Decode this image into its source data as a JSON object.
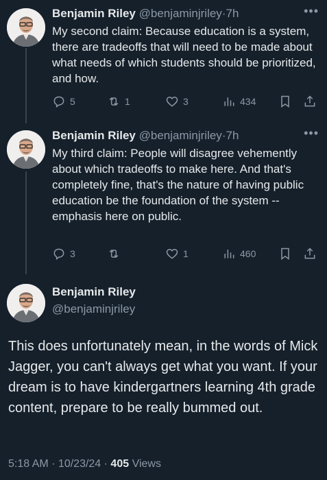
{
  "colors": {
    "background": "#15202b",
    "text": "#e7e9ea",
    "muted": "#8b98a5",
    "thread_line": "#38444d"
  },
  "tweets": [
    {
      "name": "Benjamin Riley",
      "handle": "@benjaminjriley",
      "sep": "·",
      "time": "7h",
      "text": "My second claim: Because education is a system, there are tradeoffs that will need to be made about what needs of which students should be prioritized, and how.",
      "replies": "5",
      "retweets": "1",
      "likes": "3",
      "views": "434"
    },
    {
      "name": "Benjamin Riley",
      "handle": "@benjaminjriley",
      "sep": "·",
      "time": "7h",
      "text": "My third claim: People will disagree vehemently about which tradeoffs to make here. And that's completely  fine, that's the nature of having public education be the foundation of the system -- emphasis here on public.",
      "replies": "3",
      "retweets": "",
      "likes": "1",
      "views": "460"
    }
  ],
  "main": {
    "name": "Benjamin Riley",
    "handle": "@benjaminjriley",
    "text": "This does unfortunately mean, in the words of Mick Jagger, you can't always get what you want. If your dream is to have kindergartners learning 4th grade content, prepare to be really bummed out.",
    "timestamp": "5:18 AM · 10/23/24 · ",
    "views_count": "405",
    "views_label": " Views"
  },
  "more_icon": "more-horizontal-icon"
}
